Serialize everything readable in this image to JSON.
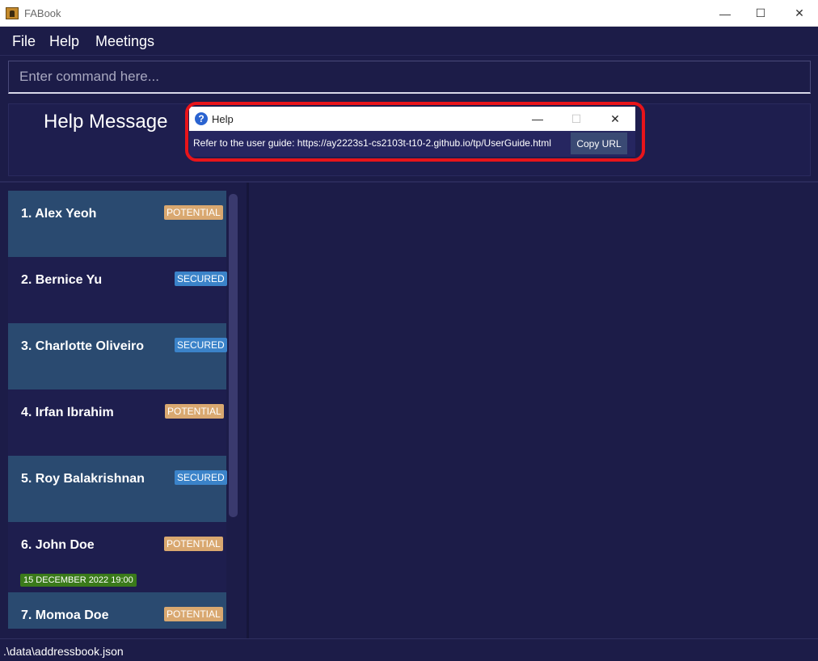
{
  "window": {
    "title": "FABook",
    "minimize_glyph": "—",
    "maximize_glyph": "☐",
    "close_glyph": "✕"
  },
  "menu": {
    "items": [
      "File",
      "Help",
      "Meetings"
    ]
  },
  "command": {
    "placeholder": "Enter command here..."
  },
  "result": {
    "message": "Help Message"
  },
  "help_window": {
    "title": "Help",
    "icon": "question-icon",
    "icon_glyph": "?",
    "text": "Refer to the user guide: https://ay2223s1-cs2103t-t10-2.github.io/tp/UserGuide.html",
    "copy_label": "Copy URL",
    "minimize_glyph": "—",
    "maximize_glyph": "☐",
    "close_glyph": "✕",
    "highlight_color": "#e8141a"
  },
  "persons": [
    {
      "name": "1.  Alex Yeoh",
      "tag": "POTENTIAL"
    },
    {
      "name": "2.  Bernice Yu",
      "tag": "SECURED"
    },
    {
      "name": "3.  Charlotte Oliveiro",
      "tag": "SECURED"
    },
    {
      "name": "4.  Irfan Ibrahim",
      "tag": "POTENTIAL"
    },
    {
      "name": "5.  Roy Balakrishnan",
      "tag": "SECURED"
    },
    {
      "name": "6.  John Doe",
      "tag": "POTENTIAL",
      "meeting": "15 DECEMBER 2022 19:00"
    },
    {
      "name": "7.  Momoa Doe",
      "tag": "POTENTIAL"
    }
  ],
  "colors": {
    "background": "#1c1c48",
    "card_alt": "#2a4a70",
    "potential_tag": "#d9a870",
    "secured_tag": "#3b83c9",
    "meeting_tag": "#3a7a1a"
  },
  "status": {
    "file_path": ".\\data\\addressbook.json"
  }
}
